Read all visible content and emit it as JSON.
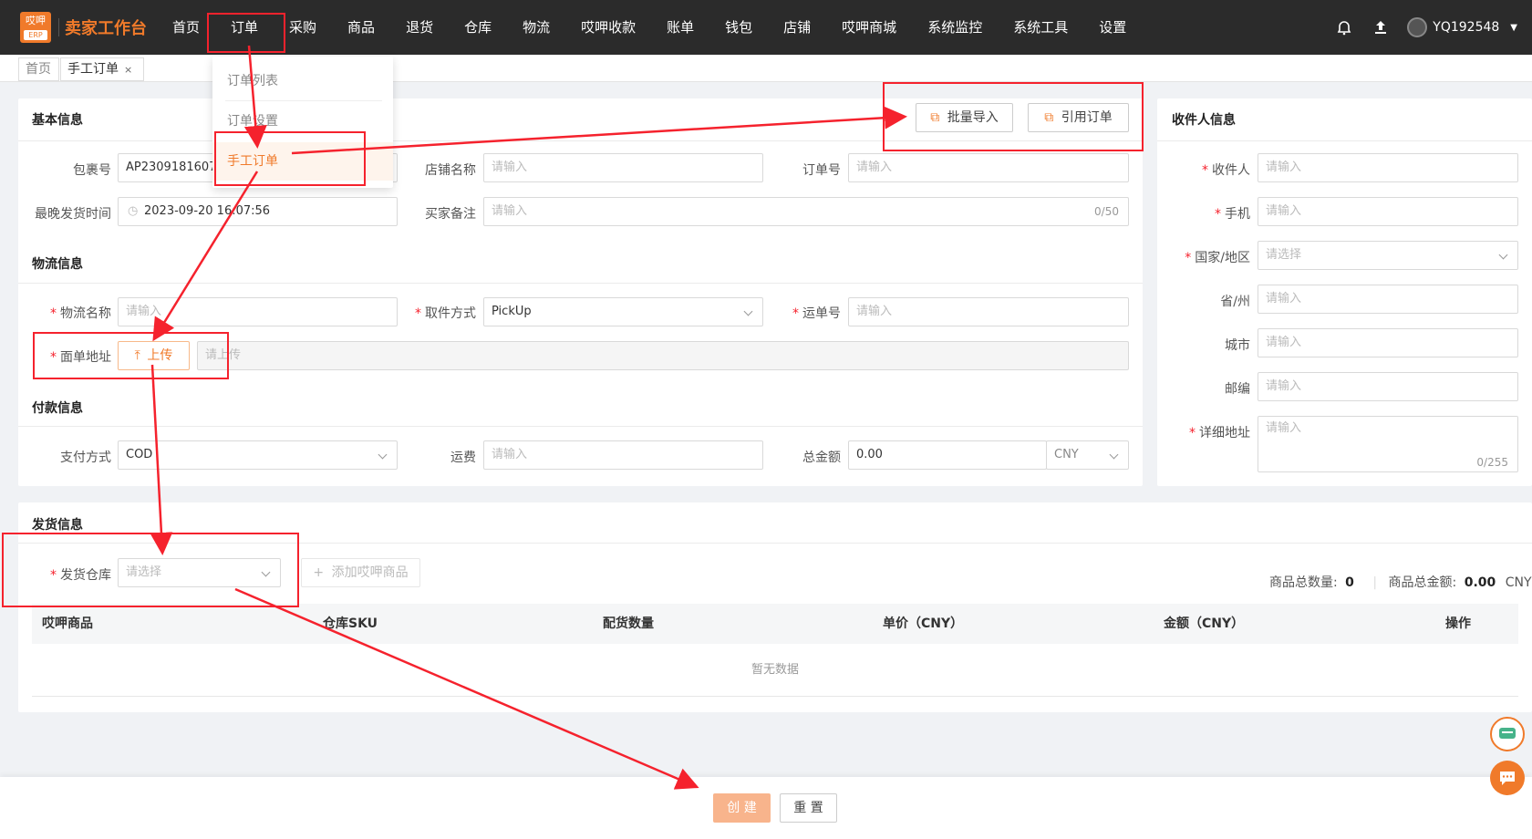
{
  "app": {
    "logo_top": "哎呷",
    "logo_erp": "ERP",
    "title": "卖家工作台"
  },
  "nav": {
    "items": [
      "首页",
      "订单",
      "采购",
      "商品",
      "退货",
      "仓库",
      "物流",
      "哎呷收款",
      "账单",
      "钱包",
      "店铺",
      "哎呷商城",
      "系统监控",
      "系统工具",
      "设置"
    ],
    "user": "YQ192548"
  },
  "tabs": {
    "home": "首页",
    "active": "手工订单",
    "close": "×"
  },
  "order_menu": {
    "items": [
      "订单列表",
      "订单设置",
      "手工订单"
    ]
  },
  "basic": {
    "title": "基本信息",
    "batch_import": "批量导入",
    "quote_order": "引用订单",
    "package_label": "包裹号",
    "package_value": "AP23091816070",
    "store_label": "店铺名称",
    "store_placeholder": "请输入",
    "order_label": "订单号",
    "order_placeholder": "请输入",
    "latest_ship_label": "最晚发货时间",
    "latest_ship_value": "2023-09-20 16:07:56",
    "buyer_note_label": "买家备注",
    "buyer_note_placeholder": "请输入",
    "buyer_note_count": "0/50"
  },
  "logistics": {
    "title": "物流信息",
    "name_label": "物流名称",
    "name_placeholder": "请输入",
    "pickup_label": "取件方式",
    "pickup_value": "PickUp",
    "tracking_label": "运单号",
    "tracking_placeholder": "请输入",
    "label_addr_label": "面单地址",
    "upload_btn": "上传",
    "upload_placeholder": "请上传"
  },
  "payment": {
    "title": "付款信息",
    "method_label": "支付方式",
    "method_value": "COD",
    "freight_label": "运费",
    "freight_placeholder": "请输入",
    "total_label": "总金额",
    "total_value": "0.00",
    "currency": "CNY"
  },
  "receiver": {
    "title": "收件人信息",
    "name_label": "收件人",
    "phone_label": "手机",
    "country_label": "国家/地区",
    "country_placeholder": "请选择",
    "province_label": "省/州",
    "city_label": "城市",
    "zip_label": "邮编",
    "address_label": "详细地址",
    "placeholder": "请输入",
    "address_count": "0/255"
  },
  "shipping": {
    "title": "发货信息",
    "warehouse_label": "发货仓库",
    "warehouse_placeholder": "请选择",
    "add_product": "添加哎呷商品",
    "total_qty_label": "商品总数量:",
    "total_qty": "0",
    "total_amount_label": "商品总金额:",
    "total_amount": "0.00",
    "total_currency": "CNY",
    "columns": [
      "哎呷商品",
      "仓库SKU",
      "配货数量",
      "单价（CNY）",
      "金额（CNY）",
      "操作"
    ],
    "empty": "暂无数据"
  },
  "footer": {
    "create": "创 建",
    "reset": "重 置"
  },
  "colors": {
    "accent": "#f07a2a",
    "annotation": "#f5222d",
    "nav_bg": "#2b2b2b"
  }
}
